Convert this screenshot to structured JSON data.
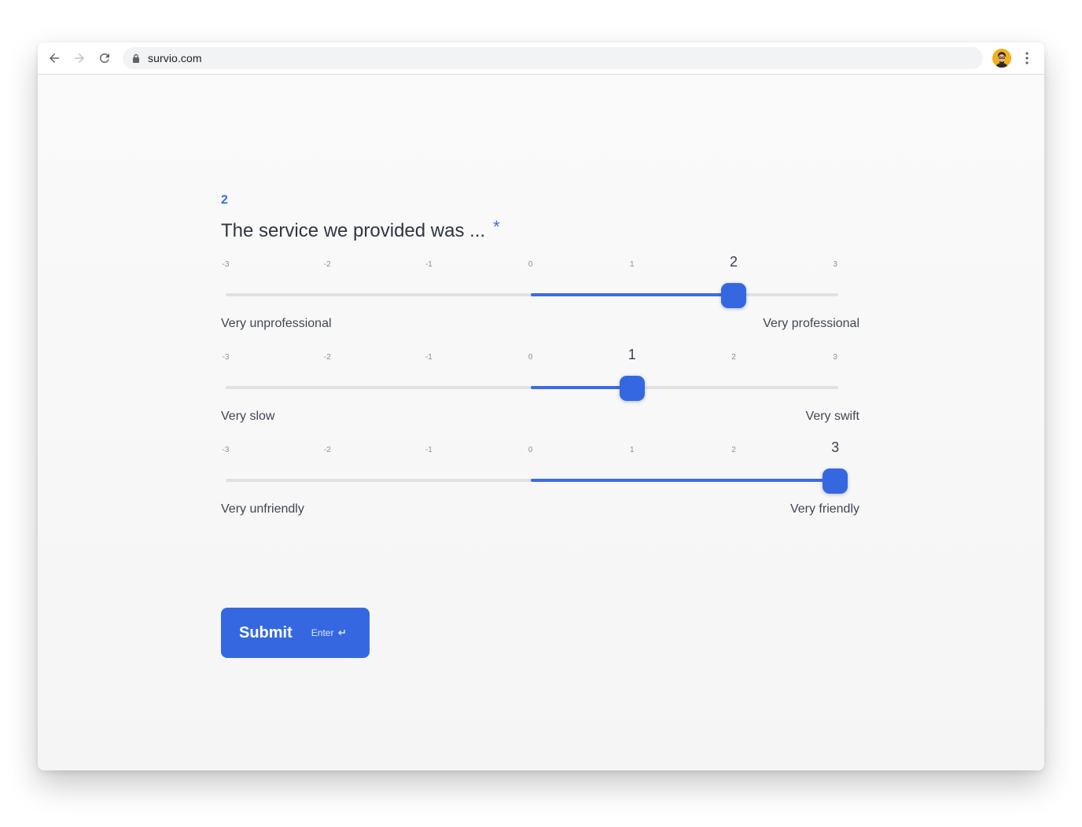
{
  "browser": {
    "url": "survio.com",
    "icons": {
      "back": "arrow-left-icon",
      "forward": "arrow-right-icon",
      "reload": "reload-icon",
      "lock": "lock-icon",
      "menu": "kebab-menu-icon"
    }
  },
  "question": {
    "number": "2",
    "text": "The service we provided was ...",
    "required_mark": "*"
  },
  "scales": [
    {
      "ticks": [
        "-3",
        "-2",
        "-1",
        "0",
        "1",
        "2",
        "3"
      ],
      "value": 2,
      "min_label": "Very unprofessional",
      "max_label": "Very professional"
    },
    {
      "ticks": [
        "-3",
        "-2",
        "-1",
        "0",
        "1",
        "2",
        "3"
      ],
      "value": 1,
      "min_label": "Very slow",
      "max_label": "Very swift"
    },
    {
      "ticks": [
        "-3",
        "-2",
        "-1",
        "0",
        "1",
        "2",
        "3"
      ],
      "value": 3,
      "min_label": "Very unfriendly",
      "max_label": "Very friendly"
    }
  ],
  "submit": {
    "label": "Submit",
    "hint": "Enter",
    "hint_icon": "enter-return-icon"
  },
  "colors": {
    "accent": "#3568e0",
    "track": "#e0e1e4"
  }
}
